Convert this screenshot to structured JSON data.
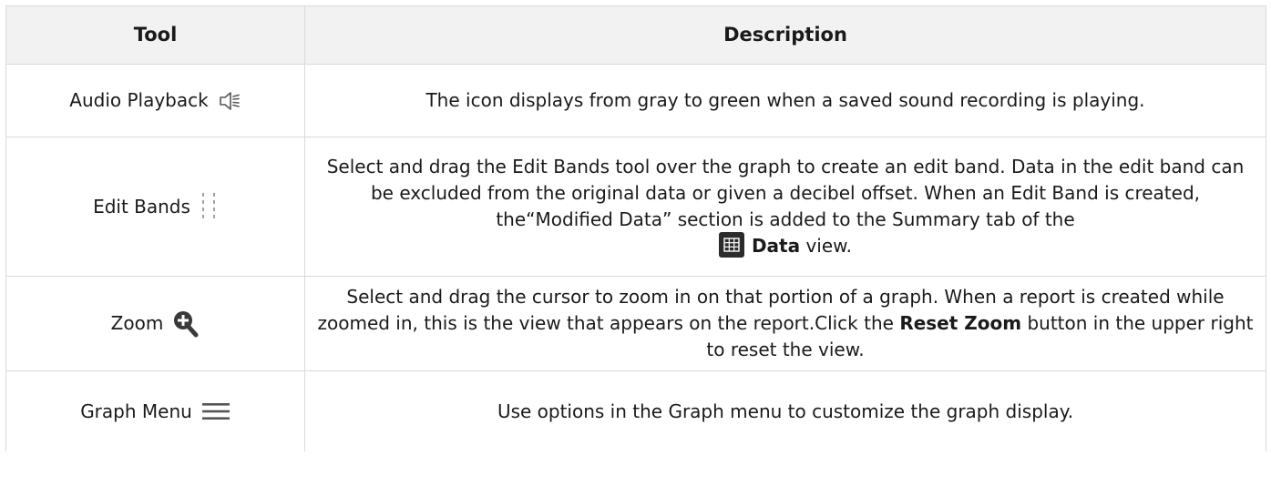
{
  "table": {
    "headers": {
      "tool": "Tool",
      "description": "Description"
    },
    "rows": [
      {
        "tool": "Audio Playback",
        "icon": "speaker-volume-icon",
        "description": "The icon displays from gray to green when a saved sound recording is playing."
      },
      {
        "tool": "Edit Bands",
        "icon": "dashed-band-icon",
        "description": "Select and drag the Edit Bands tool over the graph to create an edit band. Data in the edit band can be excluded from the original data or given a decibel offset. When an Edit Band is created, the“Modified Data” section is added to the Summary tab of the",
        "data_icon": "table-grid-icon",
        "data_label": "Data",
        "view_suffix": " view."
      },
      {
        "tool": "Zoom",
        "icon": "zoom-in-icon",
        "description_pre": "Select and drag the cursor to zoom in on that portion of a graph. When a report is created while zoomed in, this is the view that appears on the report.Click the ",
        "reset_zoom": "Reset Zoom",
        "description_post": " button in the upper right to reset the view."
      },
      {
        "tool": "Graph Menu",
        "icon": "hamburger-menu-icon",
        "description": "Use options in the Graph menu to customize the graph display."
      }
    ]
  },
  "colors": {
    "header_bg": "#f2f2f2",
    "border": "#d9d9d9",
    "icon_gray": "#555555",
    "zoom_icon": "#3a3a3a",
    "data_icon_bg": "#2b2b2b"
  }
}
